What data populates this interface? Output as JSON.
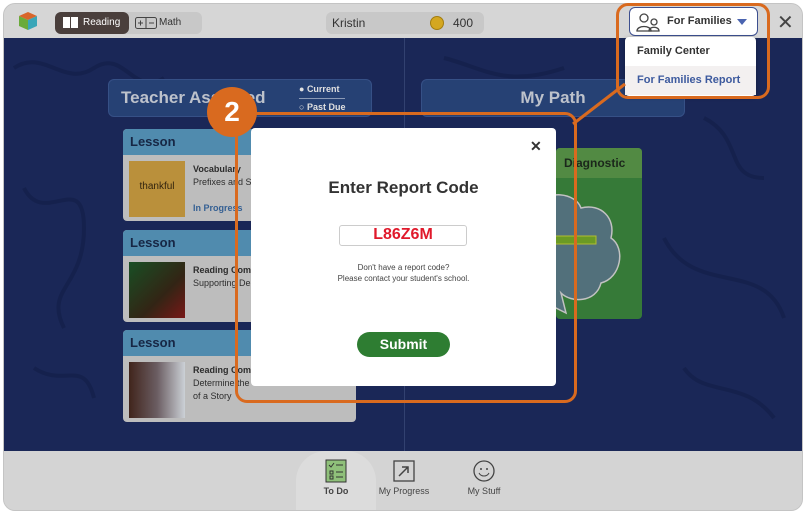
{
  "topbar": {
    "subjects": [
      {
        "label": "Reading",
        "active": true
      },
      {
        "label": "Math",
        "active": false
      }
    ],
    "user_name": "Kristin",
    "coins": "400",
    "families_button": "For Families",
    "families_menu": [
      "Family Center",
      "For Families Report"
    ]
  },
  "main": {
    "teacher_assigned": "Teacher Assigned",
    "filters": [
      "Current",
      "Past Due"
    ],
    "my_path": "My Path",
    "lessons": [
      {
        "type": "Lesson",
        "title": "Vocabulary",
        "desc": "Prefixes and S",
        "status": "In Progress",
        "thumb_text": "thankful"
      },
      {
        "type": "Lesson",
        "title": "Reading Com",
        "desc": "Supporting De"
      },
      {
        "type": "Lesson",
        "title": "Reading Com",
        "desc": "Determine the",
        "desc2": "of a Story"
      }
    ],
    "diagnostic": "Diagnostic"
  },
  "modal": {
    "title": "Enter Report Code",
    "code": "L86Z6M",
    "help_line1": "Don't have a report code?",
    "help_line2": "Please contact your student's school.",
    "submit": "Submit"
  },
  "bottom_nav": [
    {
      "label": "To Do",
      "active": true
    },
    {
      "label": "My Progress"
    },
    {
      "label": "My Stuff"
    }
  ],
  "annotation": {
    "step": "2"
  },
  "colors": {
    "accent_orange": "#d96a1f",
    "submit_green": "#2e7d32",
    "code_red": "#e0192b",
    "background_blue": "#1e2d63"
  }
}
